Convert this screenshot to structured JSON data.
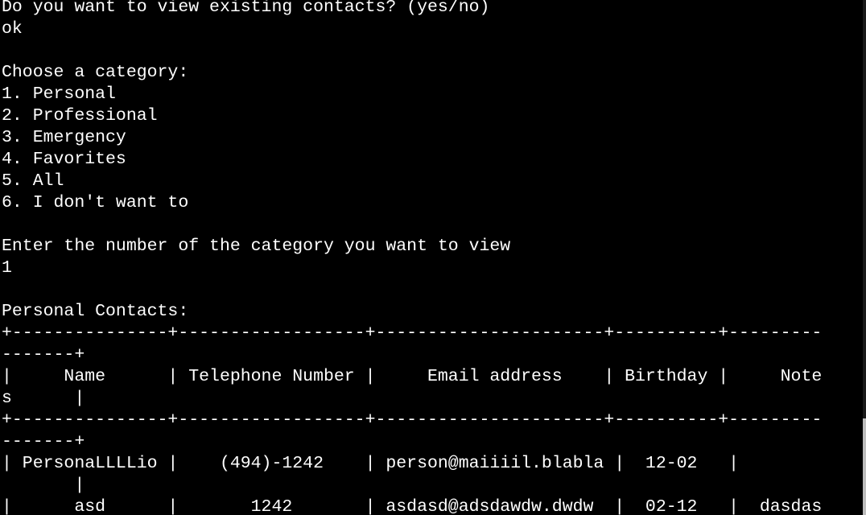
{
  "terminal": {
    "lines": [
      "Do you want to view existing contacts? (yes/no)",
      "ok",
      "",
      "Choose a category:",
      "1. Personal",
      "2. Professional",
      "3. Emergency",
      "4. Favorites",
      "5. All",
      "6. I don't want to",
      "",
      "Enter the number of the category you want to view",
      "1",
      "",
      "Personal Contacts:",
      "+---------------+------------------+----------------------+----------+---------",
      "-------+",
      "|     Name      | Telephone Number |     Email address    | Birthday |     Note",
      "s      |",
      "+---------------+------------------+----------------------+----------+---------",
      "-------+",
      "| PersonaLLLLio |    (494)-1242    | person@maiiiil.blabla |  12-02   |",
      "       |",
      "|      asd      |       1242       | asdasd@adsdawdw.dwdw  |  02-12   |  dasdas"
    ]
  },
  "colors": {
    "background": "#000000",
    "text": "#ffffff",
    "scrollbar_thumb": "#bdbdbd"
  }
}
